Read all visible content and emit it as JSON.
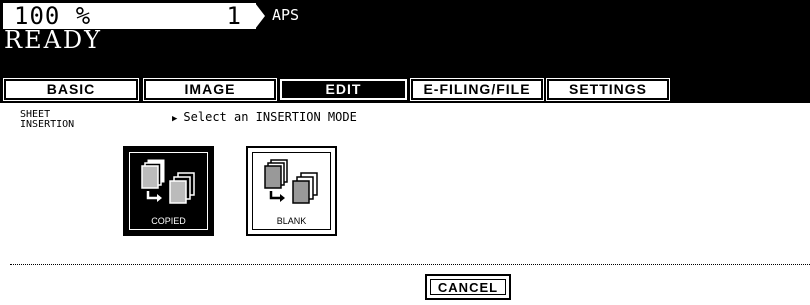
{
  "status": {
    "zoom": "100  %",
    "copies": "1",
    "paper": "APS",
    "message": "READY"
  },
  "tabs": [
    {
      "label": "BASIC",
      "active": false
    },
    {
      "label": "IMAGE",
      "active": false
    },
    {
      "label": "EDIT",
      "active": true
    },
    {
      "label": "E-FILING/FILE",
      "active": false
    },
    {
      "label": "SETTINGS",
      "active": false
    }
  ],
  "section": {
    "title_line1": "SHEET",
    "title_line2": "INSERTION",
    "prompt": "Select an INSERTION MODE"
  },
  "modes": [
    {
      "label": "COPIED",
      "selected": true,
      "icon": "copied-sheet-insertion-icon"
    },
    {
      "label": "BLANK",
      "selected": false,
      "icon": "blank-sheet-insertion-icon"
    }
  ],
  "footer": {
    "cancel_label": "CANCEL"
  },
  "colors": {
    "background": "#ffffff",
    "bar": "#000000",
    "text": "#000000"
  }
}
